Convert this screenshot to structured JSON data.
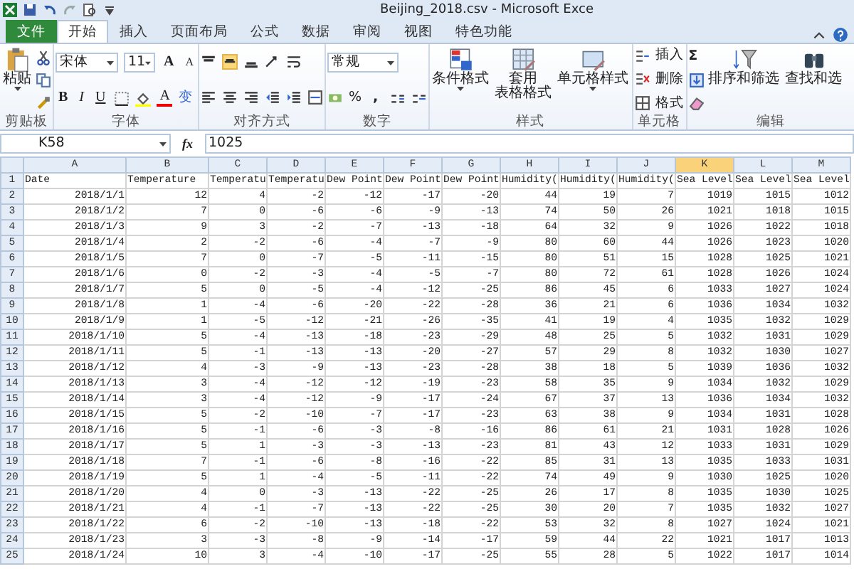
{
  "title_bar": {
    "title": "Beijing_2018.csv - Microsoft Exce"
  },
  "tabs": [
    {
      "label": "文件",
      "kind": "file",
      "selected": false
    },
    {
      "label": "开始",
      "kind": "tab",
      "selected": true
    },
    {
      "label": "插入",
      "kind": "tab",
      "selected": false
    },
    {
      "label": "页面布局",
      "kind": "tab",
      "selected": false
    },
    {
      "label": "公式",
      "kind": "tab",
      "selected": false
    },
    {
      "label": "数据",
      "kind": "tab",
      "selected": false
    },
    {
      "label": "审阅",
      "kind": "tab",
      "selected": false
    },
    {
      "label": "视图",
      "kind": "tab",
      "selected": false
    },
    {
      "label": "特色功能",
      "kind": "tab",
      "selected": false
    }
  ],
  "ribbon": {
    "clipboard": {
      "paste": "粘贴",
      "label": "剪贴板"
    },
    "font": {
      "name": "宋体",
      "size": "11",
      "grow": "A",
      "shrink": "A",
      "bold": "B",
      "italic": "I",
      "underline": "U",
      "font_color": "A",
      "phonetic": "变",
      "label": "字体"
    },
    "alignment": {
      "vertical": [
        {
          "selected": false
        },
        {
          "selected": true
        },
        {
          "selected": false
        }
      ],
      "label": "对齐方式"
    },
    "number": {
      "format": "常规",
      "percent": "%",
      "comma": ",",
      "label": "数字"
    },
    "styles": {
      "conditional": "条件格式",
      "table_format": [
        "套用",
        "表格格式"
      ],
      "cell_styles": "单元格样式",
      "label": "样式"
    },
    "cells": {
      "insert": "插入",
      "delete": "删除",
      "format": "格式",
      "label": "单元格"
    },
    "editing": {
      "sum": "Σ",
      "sort_filter": "排序和筛选",
      "find_select": "查找和选",
      "label": "编辑"
    }
  },
  "formula_bar": {
    "name_box": "K58",
    "function_label": "fx",
    "value": "1025"
  },
  "sheet": {
    "columns": [
      {
        "label": "A",
        "selected": false
      },
      {
        "label": "B",
        "selected": false
      },
      {
        "label": "C",
        "selected": false
      },
      {
        "label": "D",
        "selected": false
      },
      {
        "label": "E",
        "selected": false
      },
      {
        "label": "F",
        "selected": false
      },
      {
        "label": "G",
        "selected": false
      },
      {
        "label": "H",
        "selected": false
      },
      {
        "label": "I",
        "selected": false
      },
      {
        "label": "J",
        "selected": false
      },
      {
        "label": "K",
        "selected": true
      },
      {
        "label": "L",
        "selected": false
      },
      {
        "label": "M",
        "selected": false
      }
    ],
    "rows": [
      {
        "number": "1",
        "cells": [
          "Date",
          "Temperature",
          "Temperatu",
          "Temperatu",
          "Dew Point",
          "Dew Point",
          "Dew Point",
          "Humidity(",
          "Humidity(",
          "Humidity(",
          "Sea Level",
          "Sea Level",
          "Sea Level"
        ]
      },
      {
        "number": "2",
        "cells": [
          "2018/1/1",
          "12",
          "4",
          "-2",
          "-12",
          "-17",
          "-20",
          "44",
          "19",
          "7",
          "1019",
          "1015",
          "1012"
        ]
      },
      {
        "number": "3",
        "cells": [
          "2018/1/2",
          "7",
          "0",
          "-6",
          "-6",
          "-9",
          "-13",
          "74",
          "50",
          "26",
          "1021",
          "1018",
          "1015"
        ]
      },
      {
        "number": "4",
        "cells": [
          "2018/1/3",
          "9",
          "3",
          "-2",
          "-7",
          "-13",
          "-18",
          "64",
          "32",
          "9",
          "1026",
          "1022",
          "1018"
        ]
      },
      {
        "number": "5",
        "cells": [
          "2018/1/4",
          "2",
          "-2",
          "-6",
          "-4",
          "-7",
          "-9",
          "80",
          "60",
          "44",
          "1026",
          "1023",
          "1020"
        ]
      },
      {
        "number": "6",
        "cells": [
          "2018/1/5",
          "7",
          "0",
          "-7",
          "-5",
          "-11",
          "-15",
          "80",
          "51",
          "15",
          "1028",
          "1025",
          "1021"
        ]
      },
      {
        "number": "7",
        "cells": [
          "2018/1/6",
          "0",
          "-2",
          "-3",
          "-4",
          "-5",
          "-7",
          "80",
          "72",
          "61",
          "1028",
          "1026",
          "1024"
        ]
      },
      {
        "number": "8",
        "cells": [
          "2018/1/7",
          "5",
          "0",
          "-5",
          "-4",
          "-12",
          "-25",
          "86",
          "45",
          "6",
          "1033",
          "1027",
          "1024"
        ]
      },
      {
        "number": "9",
        "cells": [
          "2018/1/8",
          "1",
          "-4",
          "-6",
          "-20",
          "-22",
          "-28",
          "36",
          "21",
          "6",
          "1036",
          "1034",
          "1032"
        ]
      },
      {
        "number": "10",
        "cells": [
          "2018/1/9",
          "1",
          "-5",
          "-12",
          "-21",
          "-26",
          "-35",
          "41",
          "19",
          "4",
          "1035",
          "1032",
          "1029"
        ]
      },
      {
        "number": "11",
        "cells": [
          "2018/1/10",
          "5",
          "-4",
          "-13",
          "-18",
          "-23",
          "-29",
          "48",
          "25",
          "5",
          "1032",
          "1031",
          "1029"
        ]
      },
      {
        "number": "12",
        "cells": [
          "2018/1/11",
          "5",
          "-1",
          "-13",
          "-13",
          "-20",
          "-27",
          "57",
          "29",
          "8",
          "1032",
          "1030",
          "1027"
        ]
      },
      {
        "number": "13",
        "cells": [
          "2018/1/12",
          "4",
          "-3",
          "-9",
          "-13",
          "-23",
          "-28",
          "38",
          "18",
          "5",
          "1039",
          "1036",
          "1032"
        ]
      },
      {
        "number": "14",
        "cells": [
          "2018/1/13",
          "3",
          "-4",
          "-12",
          "-12",
          "-19",
          "-23",
          "58",
          "35",
          "9",
          "1034",
          "1032",
          "1029"
        ]
      },
      {
        "number": "15",
        "cells": [
          "2018/1/14",
          "3",
          "-4",
          "-12",
          "-9",
          "-17",
          "-24",
          "67",
          "37",
          "13",
          "1036",
          "1034",
          "1032"
        ]
      },
      {
        "number": "16",
        "cells": [
          "2018/1/15",
          "5",
          "-2",
          "-10",
          "-7",
          "-17",
          "-23",
          "63",
          "38",
          "9",
          "1034",
          "1031",
          "1028"
        ]
      },
      {
        "number": "17",
        "cells": [
          "2018/1/16",
          "5",
          "-1",
          "-6",
          "-3",
          "-8",
          "-16",
          "86",
          "61",
          "21",
          "1031",
          "1028",
          "1026"
        ]
      },
      {
        "number": "18",
        "cells": [
          "2018/1/17",
          "5",
          "1",
          "-3",
          "-3",
          "-13",
          "-23",
          "81",
          "43",
          "12",
          "1033",
          "1031",
          "1029"
        ]
      },
      {
        "number": "19",
        "cells": [
          "2018/1/18",
          "7",
          "-1",
          "-6",
          "-8",
          "-16",
          "-22",
          "85",
          "31",
          "13",
          "1035",
          "1033",
          "1031"
        ]
      },
      {
        "number": "20",
        "cells": [
          "2018/1/19",
          "5",
          "1",
          "-4",
          "-5",
          "-11",
          "-22",
          "74",
          "49",
          "9",
          "1030",
          "1025",
          "1020"
        ]
      },
      {
        "number": "21",
        "cells": [
          "2018/1/20",
          "4",
          "0",
          "-3",
          "-13",
          "-22",
          "-25",
          "26",
          "17",
          "8",
          "1035",
          "1030",
          "1025"
        ]
      },
      {
        "number": "22",
        "cells": [
          "2018/1/21",
          "4",
          "-1",
          "-7",
          "-13",
          "-22",
          "-25",
          "30",
          "20",
          "7",
          "1035",
          "1032",
          "1027"
        ]
      },
      {
        "number": "23",
        "cells": [
          "2018/1/22",
          "6",
          "-2",
          "-10",
          "-13",
          "-18",
          "-22",
          "53",
          "32",
          "8",
          "1027",
          "1024",
          "1021"
        ]
      },
      {
        "number": "24",
        "cells": [
          "2018/1/23",
          "3",
          "-3",
          "-8",
          "-9",
          "-14",
          "-17",
          "59",
          "44",
          "22",
          "1021",
          "1017",
          "1013"
        ]
      },
      {
        "number": "25",
        "cells": [
          "2018/1/24",
          "10",
          "3",
          "-4",
          "-10",
          "-17",
          "-25",
          "55",
          "28",
          "5",
          "1022",
          "1017",
          "1014"
        ]
      }
    ]
  }
}
